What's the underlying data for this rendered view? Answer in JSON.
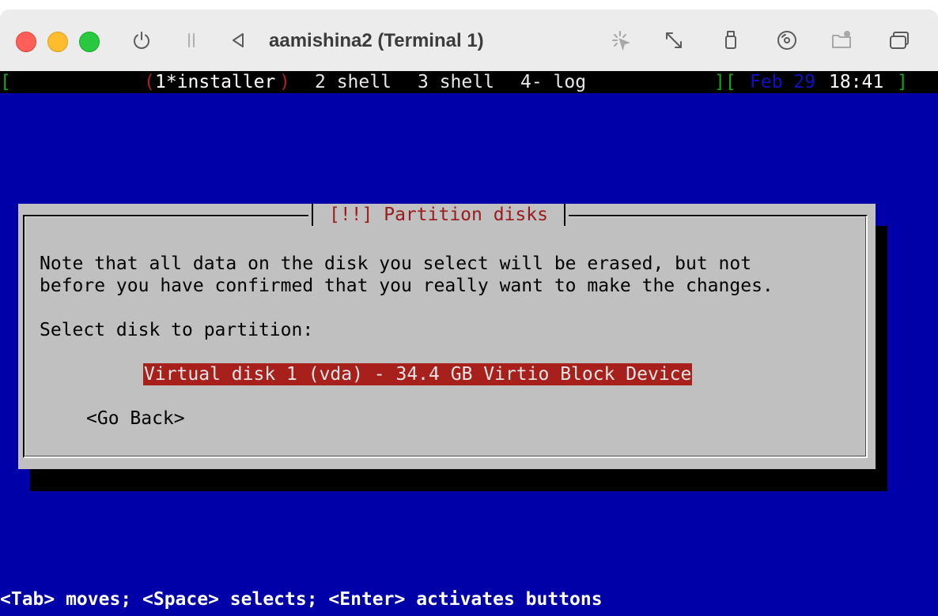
{
  "window": {
    "title": "aamishina2 (Terminal 1)"
  },
  "titlebar_icons": [
    "power-icon",
    "pause-icon",
    "back-icon",
    "capture-pointer-icon",
    "resize-icon",
    "usb-icon",
    "disc-icon",
    "shared-folder-icon",
    "windows-icon"
  ],
  "statusbar": {
    "left_bracket": "[",
    "tab1_open": "(",
    "tab1": "1*installer",
    "tab1_close": ")",
    "tab2": "2 shell",
    "tab3": "3 shell",
    "tab4": "4- log",
    "right_bracket_open": "][",
    "date": "Feb 29",
    "time": "18:41",
    "right_bracket_close": "]"
  },
  "dialog": {
    "title": "[!!] Partition disks",
    "message_line1": "Note that all data on the disk you select will be erased, but not",
    "message_line2": "before you have confirmed that you really want to make the changes.",
    "prompt": "Select disk to partition:",
    "disk_item": "Virtual disk 1 (vda) - 34.4 GB Virtio Block Device",
    "go_back": "<Go Back>"
  },
  "help_line": "<Tab> moves; <Space> selects; <Enter> activates buttons",
  "colors": {
    "terminal_bg": "#0000a8",
    "dialog_bg": "#c0c0c0",
    "selection_bg": "#a8201c",
    "title_text": "#9a1b1b"
  }
}
